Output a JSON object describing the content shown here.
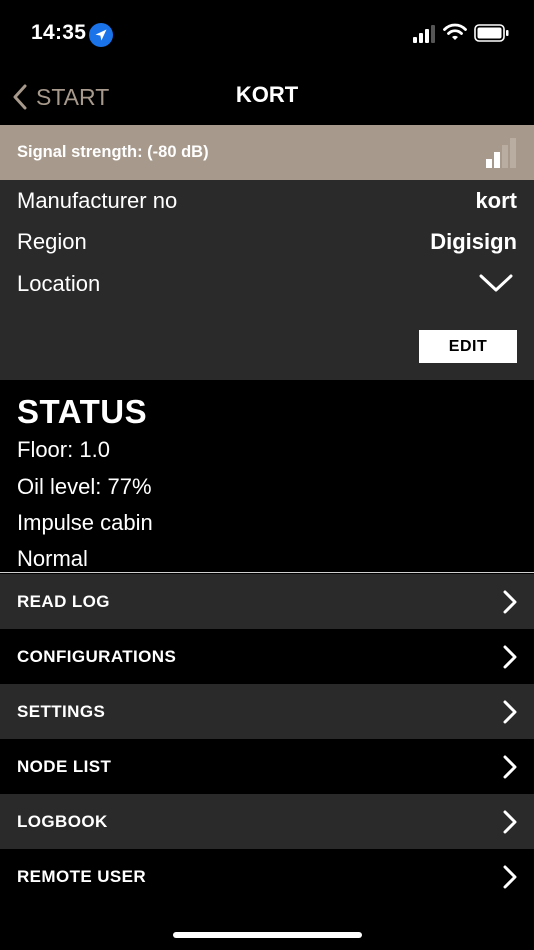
{
  "status_bar": {
    "time": "14:35"
  },
  "nav": {
    "back_label": "START",
    "title": "KORT"
  },
  "signal": {
    "text": "Signal strength: (-80 dB)",
    "bars_filled": 2,
    "bars_total": 4
  },
  "info": {
    "manufacturer_label": "Manufacturer no",
    "manufacturer_value": "kort",
    "region_label": "Region",
    "region_value": "Digisign",
    "location_label": "Location",
    "edit_label": "EDIT"
  },
  "status": {
    "title": "STATUS",
    "lines": [
      "Floor: 1.0",
      "Oil level: 77%",
      "Impulse cabin",
      "Normal"
    ]
  },
  "menu": {
    "items": [
      {
        "label": "READ LOG"
      },
      {
        "label": "CONFIGURATIONS"
      },
      {
        "label": "SETTINGS"
      },
      {
        "label": "NODE LIST"
      },
      {
        "label": "LOGBOOK"
      },
      {
        "label": "REMOTE USER"
      }
    ]
  },
  "colors": {
    "accent": "#a7998b",
    "panel": "#2a2a2a",
    "background": "#000000",
    "location_blue": "#1a73e8"
  }
}
